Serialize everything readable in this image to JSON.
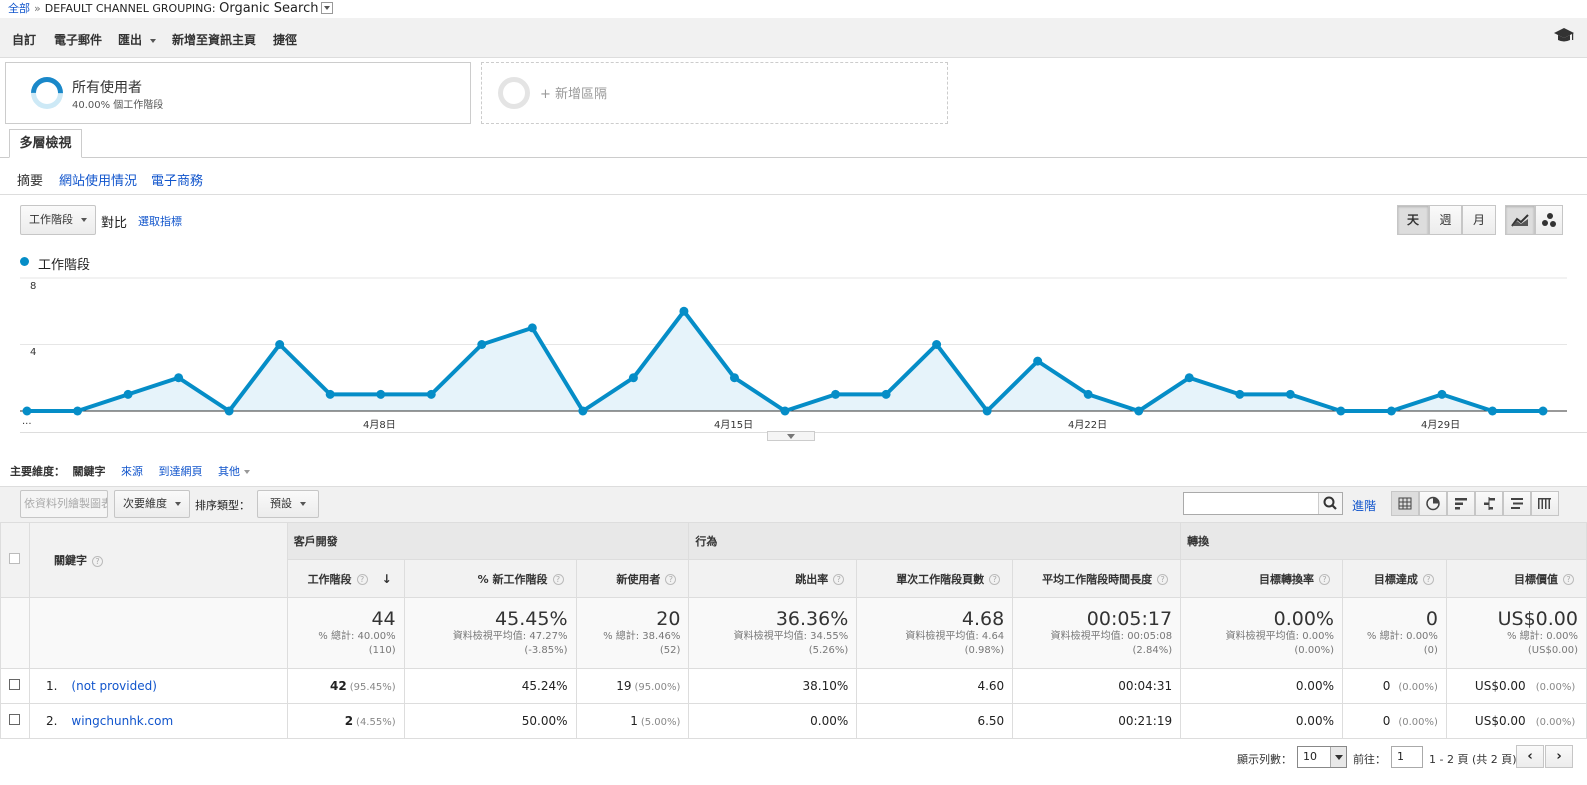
{
  "breadcrumb": {
    "all": "全部",
    "sep": "»",
    "group": "DEFAULT CHANNEL GROUPING:",
    "value": "Organic Search"
  },
  "toolbar": {
    "customize": "自訂",
    "email": "電子郵件",
    "export": "匯出",
    "add_dashboard": "新增至資訊主頁",
    "shortcut": "捷徑",
    "cap_icon": "graduation-cap-icon"
  },
  "segments": {
    "all_users": "所有使用者",
    "all_users_sub": "40.00% 個工作階段",
    "add_segment": "+ 新增區隔"
  },
  "tab": {
    "label": "多層檢視"
  },
  "subnav": {
    "summary": "摘要",
    "site_usage": "網站使用情況",
    "ecommerce": "電子商務"
  },
  "chartctrl": {
    "metric": "工作階段",
    "vs": "對比",
    "select_metric": "選取指標",
    "day": "天",
    "week": "週",
    "month": "月",
    "line_icon": "line-chart-icon",
    "motion_icon": "motion-chart-icon"
  },
  "chart_data": {
    "type": "line",
    "series": [
      {
        "name": "工作階段",
        "values": [
          0,
          0,
          1,
          2,
          0,
          4,
          1,
          1,
          1,
          4,
          5,
          0,
          2,
          6,
          2,
          0,
          1,
          1,
          4,
          0,
          3,
          1,
          0,
          2,
          1,
          1,
          0,
          0,
          1,
          0,
          0
        ]
      }
    ],
    "x_ticks": [
      "...",
      "4月8日",
      "4月15日",
      "4月22日",
      "4月29日"
    ],
    "y_ticks": [
      "4",
      "8"
    ],
    "ylim": [
      0,
      8
    ],
    "color": "#058dc7",
    "grid": true
  },
  "dimensions": {
    "label": "主要維度：",
    "keyword": "關鍵字",
    "source": "來源",
    "landing": "到達網頁",
    "other": "其他"
  },
  "tabletools": {
    "plot_rows": "依資料列繪製圖表",
    "secondary": "次要維度",
    "sort_type": "排序類型：",
    "default": "預設",
    "advanced": "進階",
    "search_placeholder": ""
  },
  "table": {
    "groups": {
      "acquisition": "客戶開發",
      "behavior": "行為",
      "conversion": "轉換"
    },
    "headers": {
      "keyword": "關鍵字",
      "sessions": "工作階段",
      "new_sessions": "% 新工作階段",
      "new_users": "新使用者",
      "bounce": "跳出率",
      "pages": "單次工作階段頁數",
      "duration": "平均工作階段時間長度",
      "goal_rate": "目標轉換率",
      "goal_comp": "目標達成",
      "goal_value": "目標價值"
    },
    "totals": {
      "sessions": {
        "v": "44",
        "s1": "% 總計: 40.00%",
        "s2": "(110)"
      },
      "new_sessions": {
        "v": "45.45%",
        "s1": "資料檢視平均值: 47.27%",
        "s2": "(-3.85%)"
      },
      "new_users": {
        "v": "20",
        "s1": "% 總計: 38.46%",
        "s2": "(52)"
      },
      "bounce": {
        "v": "36.36%",
        "s1": "資料檢視平均值: 34.55%",
        "s2": "(5.26%)"
      },
      "pages": {
        "v": "4.68",
        "s1": "資料檢視平均值: 4.64",
        "s2": "(0.98%)"
      },
      "duration": {
        "v": "00:05:17",
        "s1": "資料檢視平均值: 00:05:08",
        "s2": "(2.84%)"
      },
      "goal_rate": {
        "v": "0.00%",
        "s1": "資料檢視平均值: 0.00%",
        "s2": "(0.00%)"
      },
      "goal_comp": {
        "v": "0",
        "s1": "% 總計: 0.00%",
        "s2": "(0)"
      },
      "goal_value": {
        "v": "US$0.00",
        "s1": "% 總計: 0.00%",
        "s2": "(US$0.00)"
      }
    },
    "rows": [
      {
        "n": "1.",
        "kw": "(not provided)",
        "sessions": "42",
        "sessions_pc": "(95.45%)",
        "new_sessions": "45.24%",
        "new_users": "19",
        "new_users_pc": "(95.00%)",
        "bounce": "38.10%",
        "pages": "4.60",
        "duration": "00:04:31",
        "goal_rate": "0.00%",
        "goal_comp": "0",
        "goal_comp_pc": "(0.00%)",
        "goal_value": "US$0.00",
        "goal_value_pc": "(0.00%)"
      },
      {
        "n": "2.",
        "kw": "wingchunhk.com",
        "sessions": "2",
        "sessions_pc": "(4.55%)",
        "new_sessions": "50.00%",
        "new_users": "1",
        "new_users_pc": "(5.00%)",
        "bounce": "0.00%",
        "pages": "6.50",
        "duration": "00:21:19",
        "goal_rate": "0.00%",
        "goal_comp": "0",
        "goal_comp_pc": "(0.00%)",
        "goal_value": "US$0.00",
        "goal_value_pc": "(0.00%)"
      }
    ]
  },
  "pager": {
    "rows_label": "顯示列數：",
    "rows_value": "10",
    "goto_label": "前往：",
    "goto_value": "1",
    "range": "1 - 2 頁 (共 2 頁)",
    "prev": "‹",
    "next": "›"
  }
}
